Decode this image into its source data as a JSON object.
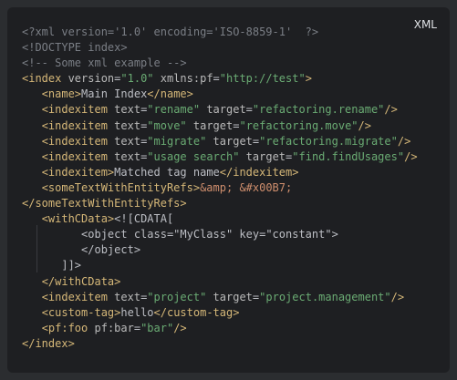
{
  "language_badge": "XML",
  "lines": [
    {
      "indent": "",
      "tokens": [
        {
          "t": "<?xml version='1.0' encoding='ISO-8859-1'  ?>",
          "c": "dim"
        }
      ]
    },
    {
      "indent": "",
      "tokens": [
        {
          "t": "<!DOCTYPE index>",
          "c": "dim"
        }
      ]
    },
    {
      "indent": "",
      "tokens": [
        {
          "t": "<!-- Some xml example -->",
          "c": "dim"
        }
      ]
    },
    {
      "indent": "",
      "tokens": [
        {
          "t": "<index",
          "c": "tag"
        },
        {
          "t": " version",
          "c": "attr"
        },
        {
          "t": "=",
          "c": "text"
        },
        {
          "t": "\"1.0\"",
          "c": "str"
        },
        {
          "t": " xmlns:pf",
          "c": "attr"
        },
        {
          "t": "=",
          "c": "text"
        },
        {
          "t": "\"http://test\"",
          "c": "str"
        },
        {
          "t": ">",
          "c": "tag"
        }
      ]
    },
    {
      "indent": "   ",
      "tokens": [
        {
          "t": "<name>",
          "c": "tag"
        },
        {
          "t": "Main Index",
          "c": "text"
        },
        {
          "t": "</name>",
          "c": "tag"
        }
      ]
    },
    {
      "indent": "   ",
      "tokens": [
        {
          "t": "<indexitem",
          "c": "tag"
        },
        {
          "t": " text",
          "c": "attr"
        },
        {
          "t": "=",
          "c": "text"
        },
        {
          "t": "\"rename\"",
          "c": "str"
        },
        {
          "t": " target",
          "c": "attr"
        },
        {
          "t": "=",
          "c": "text"
        },
        {
          "t": "\"refactoring.rename\"",
          "c": "str"
        },
        {
          "t": "/>",
          "c": "tag"
        }
      ]
    },
    {
      "indent": "   ",
      "tokens": [
        {
          "t": "<indexitem",
          "c": "tag"
        },
        {
          "t": " text",
          "c": "attr"
        },
        {
          "t": "=",
          "c": "text"
        },
        {
          "t": "\"move\"",
          "c": "str"
        },
        {
          "t": " target",
          "c": "attr"
        },
        {
          "t": "=",
          "c": "text"
        },
        {
          "t": "\"refactoring.move\"",
          "c": "str"
        },
        {
          "t": "/>",
          "c": "tag"
        }
      ]
    },
    {
      "indent": "   ",
      "tokens": [
        {
          "t": "<indexitem",
          "c": "tag"
        },
        {
          "t": " text",
          "c": "attr"
        },
        {
          "t": "=",
          "c": "text"
        },
        {
          "t": "\"migrate\"",
          "c": "str"
        },
        {
          "t": " target",
          "c": "attr"
        },
        {
          "t": "=",
          "c": "text"
        },
        {
          "t": "\"refactoring.migrate\"",
          "c": "str"
        },
        {
          "t": "/>",
          "c": "tag"
        }
      ]
    },
    {
      "indent": "   ",
      "tokens": [
        {
          "t": "<indexitem",
          "c": "tag"
        },
        {
          "t": " text",
          "c": "attr"
        },
        {
          "t": "=",
          "c": "text"
        },
        {
          "t": "\"usage search\"",
          "c": "str"
        },
        {
          "t": " target",
          "c": "attr"
        },
        {
          "t": "=",
          "c": "text"
        },
        {
          "t": "\"find.findUsages\"",
          "c": "str"
        },
        {
          "t": "/>",
          "c": "tag"
        }
      ]
    },
    {
      "indent": "   ",
      "tokens": [
        {
          "t": "<indexitem>",
          "c": "tag"
        },
        {
          "t": "Matched tag name",
          "c": "text"
        },
        {
          "t": "</indexitem>",
          "c": "tag"
        }
      ]
    },
    {
      "indent": "   ",
      "tokens": [
        {
          "t": "<someTextWithEntityRefs>",
          "c": "tag"
        },
        {
          "t": "&amp;",
          "c": "ent"
        },
        {
          "t": " ",
          "c": "text"
        },
        {
          "t": "&#x00B7;",
          "c": "ent"
        }
      ]
    },
    {
      "indent": "",
      "tokens": [
        {
          "t": "</someTextWithEntityRefs>",
          "c": "tag"
        }
      ]
    },
    {
      "indent": "   ",
      "tokens": [
        {
          "t": "<withCData>",
          "c": "tag"
        },
        {
          "t": "<![CDATA[",
          "c": "text"
        }
      ]
    },
    {
      "indent": "         ",
      "tokens": [
        {
          "t": "<object class=\"MyClass\" key=\"constant\">",
          "c": "text"
        }
      ]
    },
    {
      "indent": "         ",
      "tokens": [
        {
          "t": "</object>",
          "c": "text"
        }
      ]
    },
    {
      "indent": "      ",
      "tokens": [
        {
          "t": "]]>",
          "c": "text"
        }
      ]
    },
    {
      "indent": "   ",
      "tokens": [
        {
          "t": "</withCData>",
          "c": "tag"
        }
      ]
    },
    {
      "indent": "   ",
      "tokens": [
        {
          "t": "<indexitem",
          "c": "tag"
        },
        {
          "t": " text",
          "c": "attr"
        },
        {
          "t": "=",
          "c": "text"
        },
        {
          "t": "\"project\"",
          "c": "str"
        },
        {
          "t": " target",
          "c": "attr"
        },
        {
          "t": "=",
          "c": "text"
        },
        {
          "t": "\"project.management\"",
          "c": "str"
        },
        {
          "t": "/>",
          "c": "tag"
        }
      ]
    },
    {
      "indent": "   ",
      "tokens": [
        {
          "t": "<custom-tag>",
          "c": "tag"
        },
        {
          "t": "hello",
          "c": "text"
        },
        {
          "t": "</custom-tag>",
          "c": "tag"
        }
      ]
    },
    {
      "indent": "   ",
      "tokens": [
        {
          "t": "<pf:foo",
          "c": "tag"
        },
        {
          "t": " pf:bar",
          "c": "attr"
        },
        {
          "t": "=",
          "c": "text"
        },
        {
          "t": "\"bar\"",
          "c": "str"
        },
        {
          "t": "/>",
          "c": "tag"
        }
      ]
    },
    {
      "indent": "",
      "tokens": [
        {
          "t": "</index>",
          "c": "tag"
        }
      ]
    }
  ],
  "colors": {
    "background": "#2b2d30",
    "editor": "#1e1f22",
    "tag": "#d5b778",
    "attribute": "#bababa",
    "string": "#6aab73",
    "entity": "#cf8e6d",
    "comment": "#7a7e85",
    "text": "#bcbec4"
  }
}
